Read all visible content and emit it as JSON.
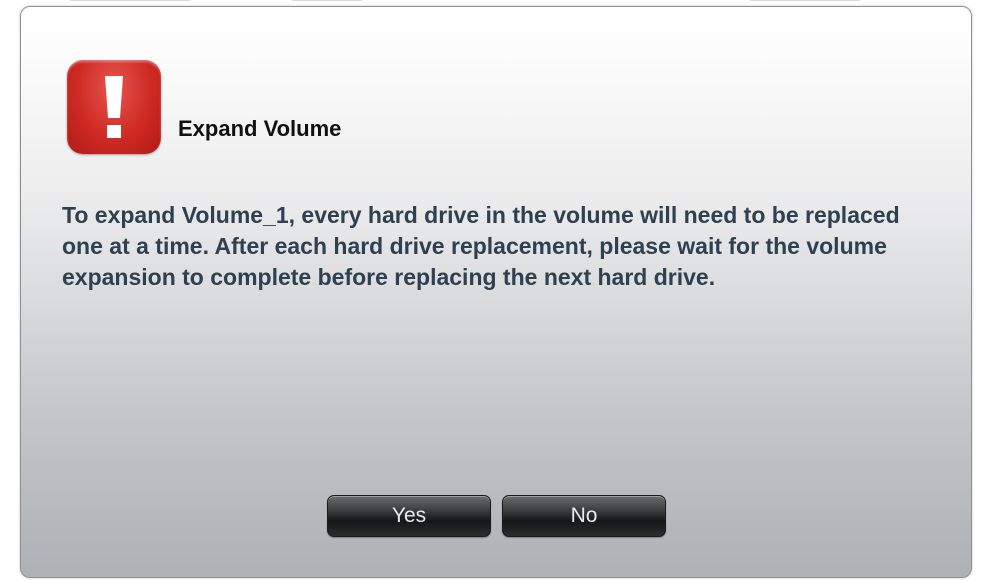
{
  "dialog": {
    "title": "Expand Volume",
    "icon": "warning-exclamation-icon",
    "message": "To expand Volume_1, every hard drive in the volume will need to be replaced one at a time. After each hard drive replacement, please wait for the volume expansion to complete before replacing the next hard drive.",
    "buttons": {
      "yes_label": "Yes",
      "no_label": "No"
    }
  },
  "colors": {
    "icon_red": "#cf2a24",
    "message_text": "#2f4050",
    "title_text": "#111111",
    "button_dark": "#151617"
  }
}
